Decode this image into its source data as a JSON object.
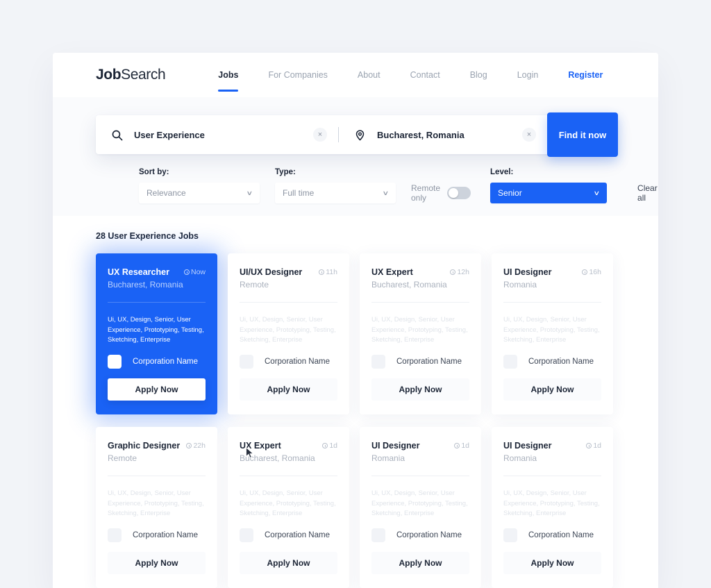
{
  "brand": {
    "bold": "Job",
    "light": "Search"
  },
  "nav": {
    "items": [
      {
        "label": "Jobs",
        "state": "active"
      },
      {
        "label": "For Companies",
        "state": "default"
      },
      {
        "label": "About",
        "state": "default"
      },
      {
        "label": "Contact",
        "state": "default"
      },
      {
        "label": "Blog",
        "state": "default"
      },
      {
        "label": "Login",
        "state": "default"
      },
      {
        "label": "Register",
        "state": "accent"
      }
    ]
  },
  "search": {
    "keyword_value": "User Experience",
    "keyword_placeholder": "User Experience",
    "location_value": "Bucharest, Romania",
    "location_placeholder": "Bucharest, Romania",
    "clear_symbol": "×",
    "submit_label": "Find it now"
  },
  "filters": {
    "sort_label": "Sort by:",
    "sort_value": "Relevance",
    "type_label": "Type:",
    "type_value": "Full time",
    "remote_label": "Remote only",
    "remote_on": false,
    "level_label": "Level:",
    "level_value": "Senior",
    "clear_all_label": "Clear all",
    "chevron": "∨"
  },
  "results": {
    "heading": "28 User Experience Jobs",
    "tags_text": "Ui, UX, Design, Senior, User Experience, Prototyping, Testing, Sketching, Enterprise",
    "corp_name": "Corporation Name",
    "apply_label": "Apply Now",
    "cards": [
      {
        "title": "UX Researcher",
        "time": "Now",
        "location": "Bucharest, Romania",
        "active": true
      },
      {
        "title": "UI/UX Designer",
        "time": "11h",
        "location": "Remote",
        "active": false
      },
      {
        "title": "UX Expert",
        "time": "12h",
        "location": "Bucharest, Romania",
        "active": false
      },
      {
        "title": "UI Designer",
        "time": "16h",
        "location": "Romania",
        "active": false
      },
      {
        "title": "Graphic Designer",
        "time": "22h",
        "location": "Remote",
        "active": false
      },
      {
        "title": "UX Expert",
        "time": "1d",
        "location": "Bucharest, Romania",
        "active": false
      },
      {
        "title": "UI Designer",
        "time": "1d",
        "location": "Romania",
        "active": false
      },
      {
        "title": "UI Designer",
        "time": "1d",
        "location": "Romania",
        "active": false
      }
    ]
  },
  "colors": {
    "accent": "#1a62f5",
    "page_bg": "#f2f4f8",
    "panel_bg": "#fafbfd",
    "text_dark": "#1c2536",
    "text_muted": "#9aa3b0"
  }
}
